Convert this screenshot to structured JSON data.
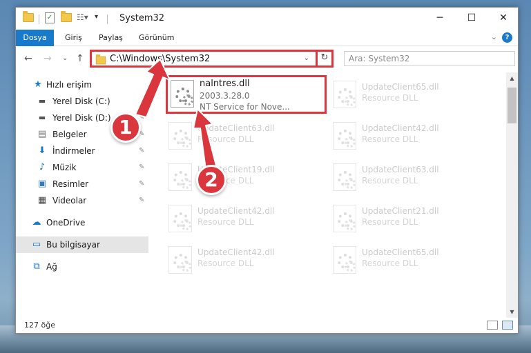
{
  "window": {
    "title": "System32",
    "minimize": "─",
    "maximize": "☐",
    "close": "✕"
  },
  "ribbon": {
    "tabs": [
      "Dosya",
      "Giriş",
      "Paylaş",
      "Görünüm"
    ],
    "help": "?",
    "collapse": "⌄"
  },
  "nav": {
    "back": "←",
    "forward": "→",
    "recent": "⌄",
    "up": "↑"
  },
  "address": {
    "path": "C:\\Windows\\System32",
    "dropdown": "⌄",
    "refresh": "↻"
  },
  "search": {
    "placeholder": "Ara: System32"
  },
  "sidebar": {
    "items": [
      {
        "label": "Hızlı erişim",
        "icon": "star-icon"
      },
      {
        "label": "Yerel Disk (C:)",
        "icon": "drive-icon"
      },
      {
        "label": "Yerel Disk (D:)",
        "icon": "drive-icon"
      },
      {
        "label": "Belgeler",
        "icon": "documents-icon"
      },
      {
        "label": "İndirmeler",
        "icon": "download-icon"
      },
      {
        "label": "Müzik",
        "icon": "music-icon"
      },
      {
        "label": "Resimler",
        "icon": "pictures-icon"
      },
      {
        "label": "Videolar",
        "icon": "videos-icon"
      },
      {
        "label": "OneDrive",
        "icon": "cloud-icon"
      },
      {
        "label": "Bu bilgisayar",
        "icon": "computer-icon"
      },
      {
        "label": "Ağ",
        "icon": "network-icon"
      }
    ]
  },
  "files": {
    "highlighted": {
      "name": "nalntres.dll",
      "version": "2003.3.28.0",
      "description": "NT Service for Nove..."
    },
    "items": [
      {
        "name": "UpdateClient65.dll",
        "type": "Resource DLL"
      },
      {
        "name": "UpdateClient63.dll",
        "type": "Resource DLL"
      },
      {
        "name": "UpdateClient42.dll",
        "type": "Resource DLL"
      },
      {
        "name": "UpdateClient19.dll",
        "type": "Resource DLL"
      },
      {
        "name": "UpdateClient63.dll",
        "type": "Resource DLL"
      },
      {
        "name": "UpdateClient42.dll",
        "type": "Resource DLL"
      },
      {
        "name": "UpdateClient21.dll",
        "type": "Resource DLL"
      },
      {
        "name": "UpdateClient42.dll",
        "type": "Resource DLL"
      },
      {
        "name": "UpdateClient65.dll",
        "type": "Resource DLL"
      }
    ]
  },
  "status": {
    "count": "127 öğe"
  },
  "callouts": [
    "1",
    "2"
  ],
  "colors": {
    "accent": "#1979ca",
    "highlight": "#d9363e",
    "selected": "#cce8ff"
  }
}
